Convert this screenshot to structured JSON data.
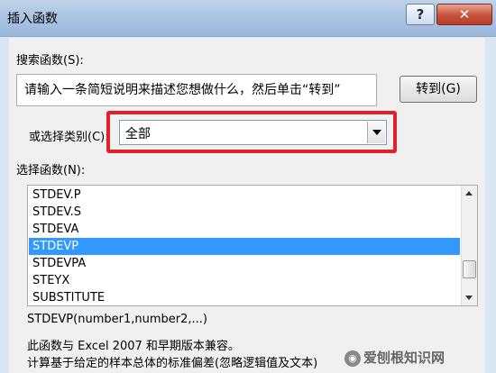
{
  "window": {
    "title": "插入函数",
    "help_label": "?",
    "close_label": "✕"
  },
  "search": {
    "label": "搜索函数(S):",
    "value": "请输入一条简短说明来描述您想做什么，然后单击“转到”",
    "goto_label": "转到(G)"
  },
  "category": {
    "label": "或选择类别(C):",
    "selected": "全部"
  },
  "functions": {
    "label": "选择函数(N):",
    "items": [
      "STDEV.P",
      "STDEV.S",
      "STDEVA",
      "STDEVP",
      "STDEVPA",
      "STEYX",
      "SUBSTITUTE"
    ],
    "selected_index": 3
  },
  "description": {
    "signature": "STDEVP(number1,number2,...)",
    "line1": "此函数与 Excel 2007 和早期版本兼容。",
    "line2": "计算基于给定的样本总体的标准偏差(忽略逻辑值及文本)"
  },
  "watermark": {
    "text": "爱刨根知识网"
  },
  "colors": {
    "highlight": "#e0202a",
    "selection": "#3399ff"
  }
}
